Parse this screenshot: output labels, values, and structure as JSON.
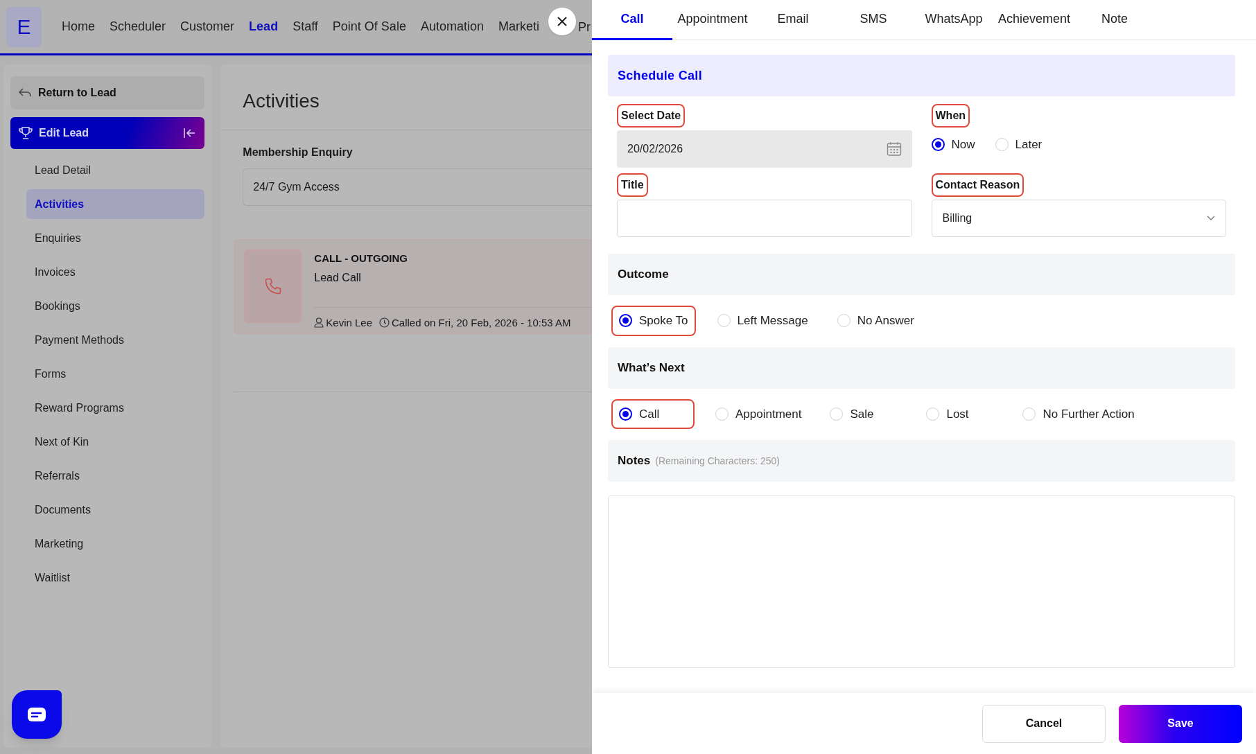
{
  "top_nav": {
    "logo": "E",
    "items": [
      {
        "label": "Home",
        "selected": false
      },
      {
        "label": "Scheduler",
        "selected": false
      },
      {
        "label": "Customer",
        "selected": false
      },
      {
        "label": "Lead",
        "selected": true
      },
      {
        "label": "Staff",
        "selected": false
      },
      {
        "label": "Point Of Sale",
        "selected": false
      },
      {
        "label": "Automation",
        "selected": false
      },
      {
        "label": "Marketi",
        "selected": false
      },
      {
        "label": "Pr",
        "selected": false
      }
    ]
  },
  "sidebar": {
    "return_link": "Return to Lead",
    "header": "Edit Lead",
    "items": [
      {
        "label": "Lead Detail",
        "selected": false
      },
      {
        "label": "Activities",
        "selected": true
      },
      {
        "label": "Enquiries",
        "selected": false
      },
      {
        "label": "Invoices",
        "selected": false
      },
      {
        "label": "Bookings",
        "selected": false
      },
      {
        "label": "Payment Methods",
        "selected": false
      },
      {
        "label": "Forms",
        "selected": false
      },
      {
        "label": "Reward Programs",
        "selected": false
      },
      {
        "label": "Next of Kin",
        "selected": false
      },
      {
        "label": "Referrals",
        "selected": false
      },
      {
        "label": "Documents",
        "selected": false
      },
      {
        "label": "Marketing",
        "selected": false
      },
      {
        "label": "Waitlist",
        "selected": false
      }
    ]
  },
  "main": {
    "title": "Activities",
    "enquiry": {
      "label": "Membership Enquiry",
      "value": "24/7 Gym Access"
    },
    "activities": [
      {
        "type": "CALL - OUTGOING",
        "title": "Lead Call",
        "user": "Kevin Lee",
        "time": "Called on Fri, 20 Feb, 2026 - 10:53 AM"
      }
    ]
  },
  "panel": {
    "tabs": [
      {
        "label": "Call",
        "selected": true
      },
      {
        "label": "Appointment",
        "selected": false
      },
      {
        "label": "Email",
        "selected": false
      },
      {
        "label": "SMS",
        "selected": false
      },
      {
        "label": "WhatsApp",
        "selected": false
      },
      {
        "label": "Achievement",
        "selected": false
      },
      {
        "label": "Note",
        "selected": false
      }
    ],
    "schedule_title": "Schedule Call",
    "select_date": {
      "label": "Select Date",
      "highlighted": true,
      "value": "20/02/2026"
    },
    "when": {
      "label": "When",
      "highlighted": true,
      "options": [
        {
          "label": "Now",
          "selected": true,
          "highlighted": false
        },
        {
          "label": "Later",
          "selected": false,
          "highlighted": false
        }
      ]
    },
    "title_field": {
      "label": "Title",
      "highlighted": true
    },
    "contact_reason": {
      "label": "Contact Reason",
      "highlighted": true,
      "value": "Billing"
    },
    "outcome": {
      "heading": "Outcome",
      "options": [
        {
          "label": "Spoke To",
          "selected": true,
          "highlighted": true
        },
        {
          "label": "Left Message",
          "selected": false,
          "highlighted": false
        },
        {
          "label": "No Answer",
          "selected": false,
          "highlighted": false
        }
      ]
    },
    "whats_next": {
      "heading": "What’s Next",
      "options": [
        {
          "label": "Call",
          "selected": true,
          "highlighted": true
        },
        {
          "label": "Appointment",
          "selected": false,
          "highlighted": false
        },
        {
          "label": "Sale",
          "selected": false,
          "highlighted": false
        },
        {
          "label": "Lost",
          "selected": false,
          "highlighted": false
        },
        {
          "label": "No Further Action",
          "selected": false,
          "highlighted": false
        }
      ]
    },
    "notes": {
      "heading": "Notes",
      "hint": "(Remaining Characters: 250)"
    },
    "buttons": {
      "cancel": "Cancel",
      "save": "Save"
    }
  }
}
